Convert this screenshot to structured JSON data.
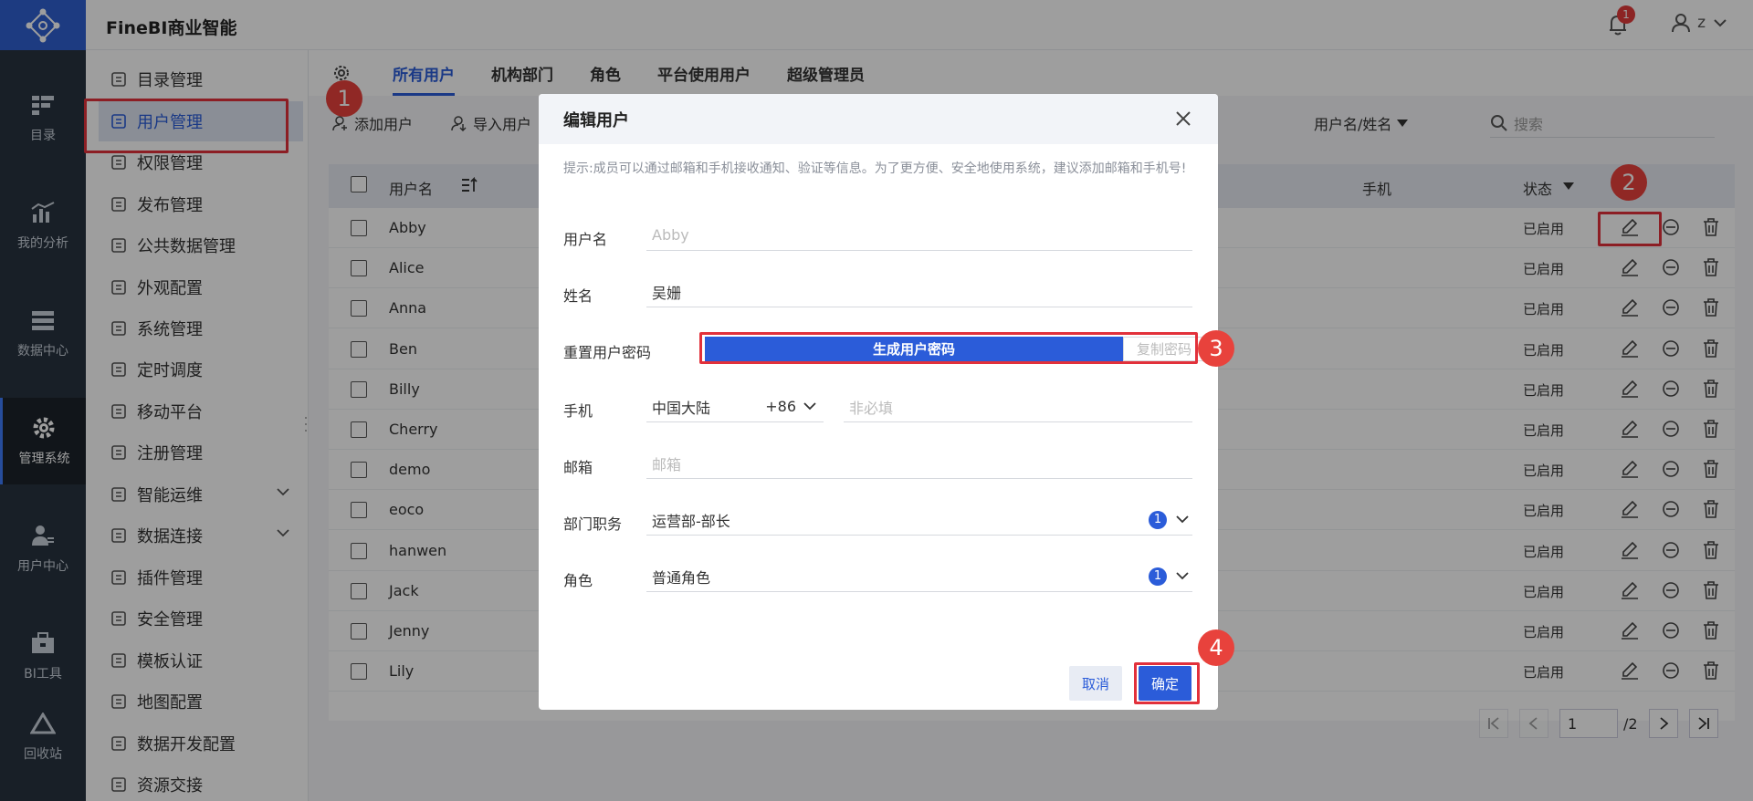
{
  "app": {
    "title": "FineBI商业智能",
    "notification_count": "1",
    "user": "z"
  },
  "leftnav": {
    "items": [
      {
        "label": "目录",
        "icon": "catalog-icon"
      },
      {
        "label": "我的分析",
        "icon": "analysis-icon"
      },
      {
        "label": "数据中心",
        "icon": "data-center-icon"
      },
      {
        "label": "管理系统",
        "icon": "gear-icon",
        "active": true
      },
      {
        "label": "用户中心",
        "icon": "user-center-icon"
      },
      {
        "label": "BI工具",
        "icon": "toolbox-icon"
      },
      {
        "label": "回收站",
        "icon": "recycle-icon"
      }
    ]
  },
  "menu": {
    "items": [
      {
        "label": "目录管理",
        "icon": "list-icon"
      },
      {
        "label": "用户管理",
        "icon": "user-icon",
        "selected": true
      },
      {
        "label": "权限管理",
        "icon": "shield-icon"
      },
      {
        "label": "发布管理",
        "icon": "publish-icon"
      },
      {
        "label": "公共数据管理",
        "icon": "briefcase-icon"
      },
      {
        "label": "外观配置",
        "icon": "brush-icon"
      },
      {
        "label": "系统管理",
        "icon": "gear-icon"
      },
      {
        "label": "定时调度",
        "icon": "timer-icon"
      },
      {
        "label": "移动平台",
        "icon": "mobile-icon"
      },
      {
        "label": "注册管理",
        "icon": "register-icon"
      },
      {
        "label": "智能运维",
        "icon": "ops-icon",
        "expandable": true
      },
      {
        "label": "数据连接",
        "icon": "link-icon",
        "expandable": true
      },
      {
        "label": "插件管理",
        "icon": "plugin-icon"
      },
      {
        "label": "安全管理",
        "icon": "security-icon"
      },
      {
        "label": "模板认证",
        "icon": "template-icon"
      },
      {
        "label": "地图配置",
        "icon": "map-icon"
      },
      {
        "label": "数据开发配置",
        "icon": "dev-config-icon"
      },
      {
        "label": "资源交接",
        "icon": "handover-icon"
      }
    ]
  },
  "tabs": [
    "所有用户",
    "机构部门",
    "角色",
    "平台使用用户",
    "超级管理员"
  ],
  "toolbar": {
    "add_user": "添加用户",
    "import_user": "导入用户",
    "filter_type": "用户名/姓名",
    "search_placeholder": "搜索"
  },
  "table": {
    "headers": {
      "username": "用户名",
      "phone": "手机",
      "status": "状态"
    },
    "rows": [
      {
        "username": "Abby",
        "status": "已启用"
      },
      {
        "username": "Alice",
        "status": "已启用"
      },
      {
        "username": "Anna",
        "status": "已启用"
      },
      {
        "username": "Ben",
        "status": "已启用"
      },
      {
        "username": "Billy",
        "status": "已启用"
      },
      {
        "username": "Cherry",
        "status": "已启用"
      },
      {
        "username": "demo",
        "status": "已启用"
      },
      {
        "username": "eoco",
        "status": "已启用"
      },
      {
        "username": "hanwen",
        "status": "已启用"
      },
      {
        "username": "Jack",
        "status": "已启用"
      },
      {
        "username": "Jenny",
        "status": "已启用"
      },
      {
        "username": "Lily",
        "status": "已启用"
      }
    ]
  },
  "pager": {
    "current": "1",
    "total": "/2"
  },
  "modal": {
    "title": "编辑用户",
    "tip": "提示:成员可以通过邮箱和手机接收通知、验证等信息。为了更方便、安全地使用系统，建议添加邮箱和手机号!",
    "username_label": "用户名",
    "username_value": "Abby",
    "name_label": "姓名",
    "name_value": "吴姗",
    "reset_label": "重置用户密码",
    "gen_button": "生成用户密码",
    "copy_button": "复制密码",
    "phone_label": "手机",
    "region": "中国大陆",
    "code": "+86",
    "phone_placeholder": "非必填",
    "email_label": "邮箱",
    "email_placeholder": "邮箱",
    "dept_label": "部门职务",
    "dept_value": "运营部-部长",
    "dept_count": "1",
    "role_label": "角色",
    "role_value": "普通角色",
    "role_count": "1",
    "cancel": "取消",
    "ok": "确定"
  },
  "steps": [
    "1",
    "2",
    "3",
    "4"
  ],
  "colors": {
    "accent": "#2b5cd9",
    "highlight": "#e2313b",
    "nav_bg": "#28333f"
  }
}
